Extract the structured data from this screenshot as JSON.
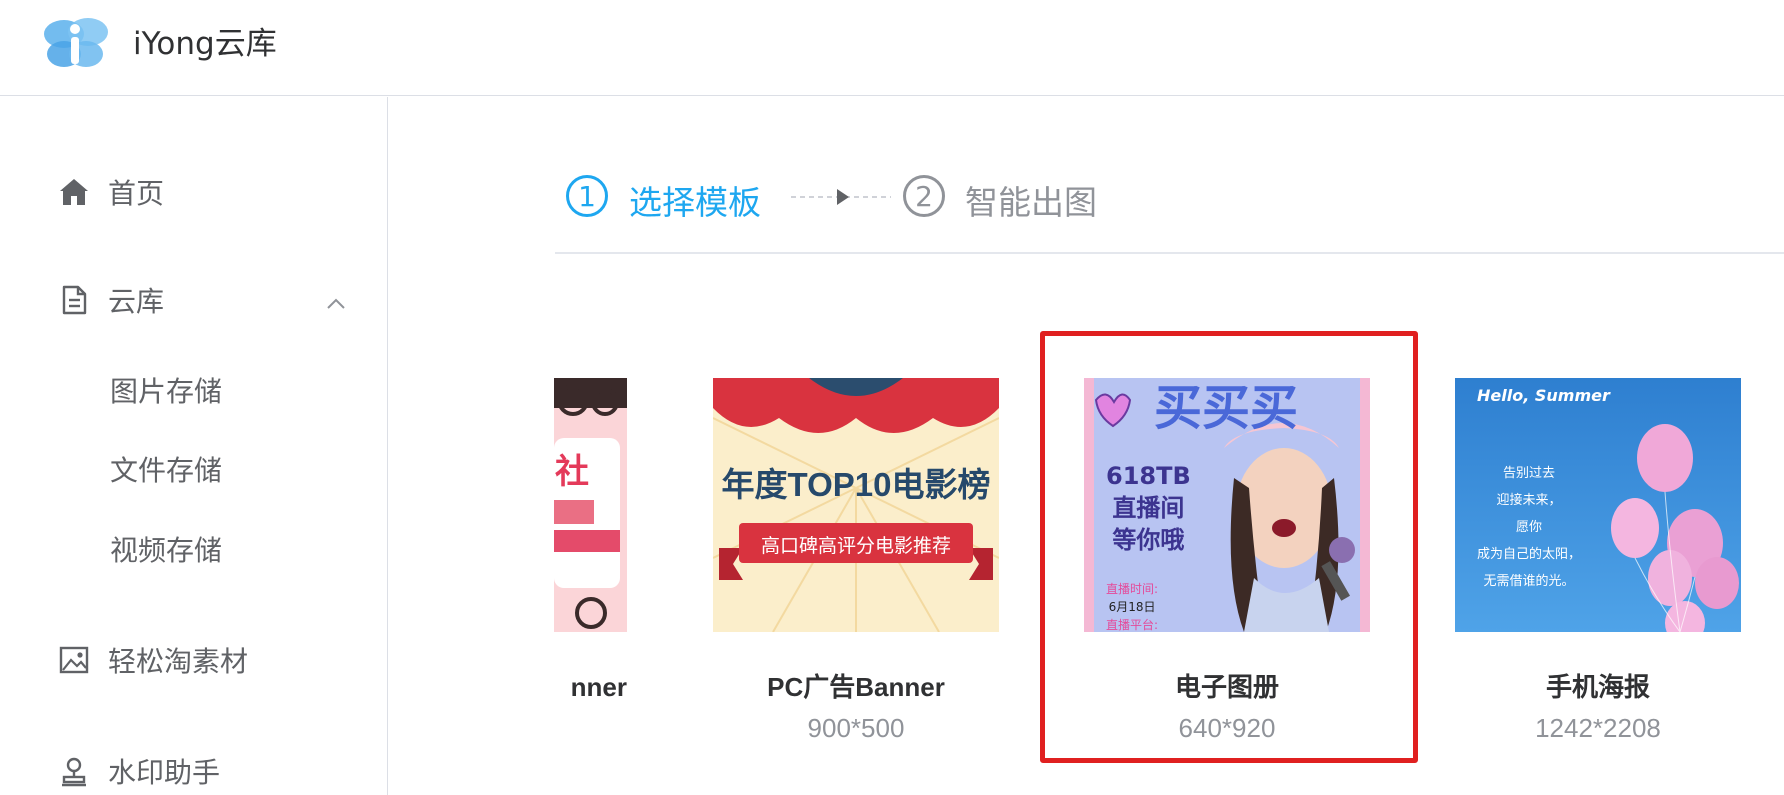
{
  "header": {
    "app_title": "iYong云库",
    "logo_icon": "iyong-logo-icon"
  },
  "sidebar": {
    "items": [
      {
        "label": "首页",
        "icon": "home-icon"
      },
      {
        "label": "云库",
        "icon": "document-icon",
        "expanded": true,
        "children": [
          {
            "label": "图片存储"
          },
          {
            "label": "文件存储"
          },
          {
            "label": "视频存储"
          }
        ]
      },
      {
        "label": "轻松淘素材",
        "icon": "image-icon"
      },
      {
        "label": "水印助手",
        "icon": "stamp-icon"
      }
    ]
  },
  "steps": [
    {
      "number": "1",
      "label": "选择模板",
      "active": true
    },
    {
      "number": "2",
      "label": "智能出图",
      "active": false
    }
  ],
  "templates": [
    {
      "name": "nner",
      "size": "",
      "partial": true,
      "thumb_text": [
        "社"
      ]
    },
    {
      "name": "PC广告Banner",
      "size": "900*500",
      "thumb_text": [
        "年度TOP10电影榜",
        "高口碑高评分电影推荐"
      ]
    },
    {
      "name": "电子图册",
      "size": "640*920",
      "selected": true,
      "thumb_text": [
        "买买买",
        "618TB",
        "直播间",
        "等你哦",
        "直播时间:",
        "6月18日",
        "直播平台:"
      ]
    },
    {
      "name": "手机海报",
      "size": "1242*2208",
      "thumb_text": [
        "Hello, Summer",
        "告别过去",
        "迎接未来，",
        "愿你",
        "成为自己的太阳，",
        "无需借谁的光。"
      ]
    }
  ],
  "colors": {
    "accent": "#1ea7f0",
    "selected_border": "#e02020",
    "muted": "#909399",
    "text": "#303133"
  }
}
